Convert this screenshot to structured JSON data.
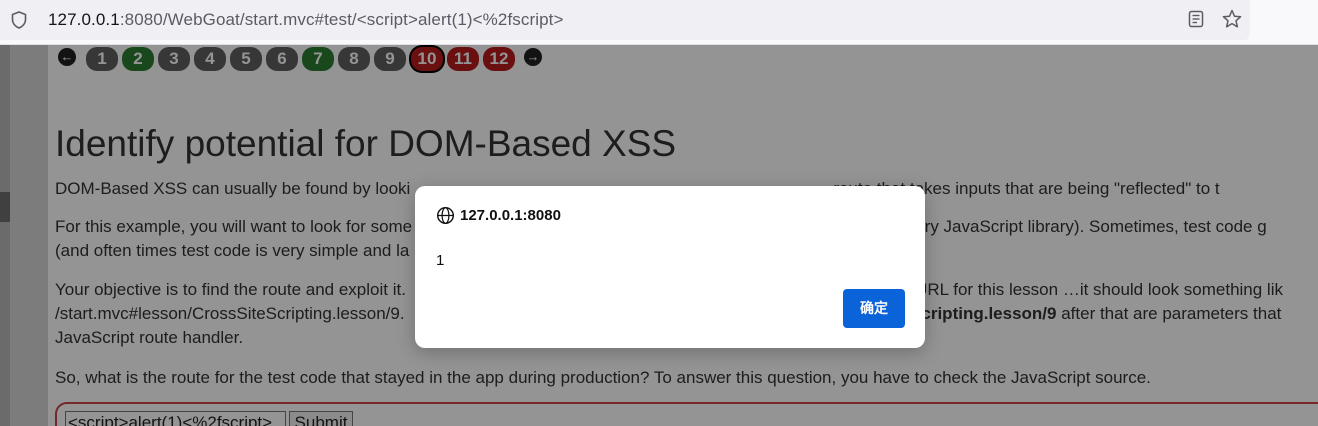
{
  "browser": {
    "url_host": "127.0.0.1",
    "url_rest": ":8080/WebGoat/start.mvc#test/<script>alert(1)<%2fscript>"
  },
  "pager": {
    "prev_icon": "←",
    "next_icon": "→",
    "pages": [
      {
        "label": "1",
        "status": "gray"
      },
      {
        "label": "2",
        "status": "green"
      },
      {
        "label": "3",
        "status": "gray"
      },
      {
        "label": "4",
        "status": "gray"
      },
      {
        "label": "5",
        "status": "gray"
      },
      {
        "label": "6",
        "status": "gray"
      },
      {
        "label": "7",
        "status": "green"
      },
      {
        "label": "8",
        "status": "gray"
      },
      {
        "label": "9",
        "status": "gray"
      },
      {
        "label": "10",
        "status": "red",
        "current": true
      },
      {
        "label": "11",
        "status": "red"
      },
      {
        "label": "12",
        "status": "red"
      }
    ]
  },
  "lesson": {
    "title": "Identify potential for DOM-Based XSS",
    "p1": "DOM-Based XSS can usually be found by looki",
    "p1_b": "route that takes inputs that are being \"reflected\" to t",
    "p2": "For this example, you will want to look for some",
    "p2_b": "primary JavaScript library). Sometimes, test code g",
    "p2_line2": "(and often times test code is very simple and la",
    "p3": "Your objective is to find the route and exploit it.",
    "p3_b": "e URL for this lesson …it should look something lik",
    "p3_line2": "/start.mvc#lesson/CrossSiteScripting.lesson/9.",
    "p3_line2_bold": "eScripting.lesson/9",
    "p3_line2_tail": " after that are parameters that",
    "p3_line3": "JavaScript route handler.",
    "p4": "So, what is the route for the test code that stayed in the app during production? To answer this question, you have to check the JavaScript source.",
    "input_value": "<script>alert(1)<%2fscript>",
    "submit_label": "Submit"
  },
  "dialog": {
    "origin": "127.0.0.1:8080",
    "message": "1",
    "ok_label": "确定"
  }
}
